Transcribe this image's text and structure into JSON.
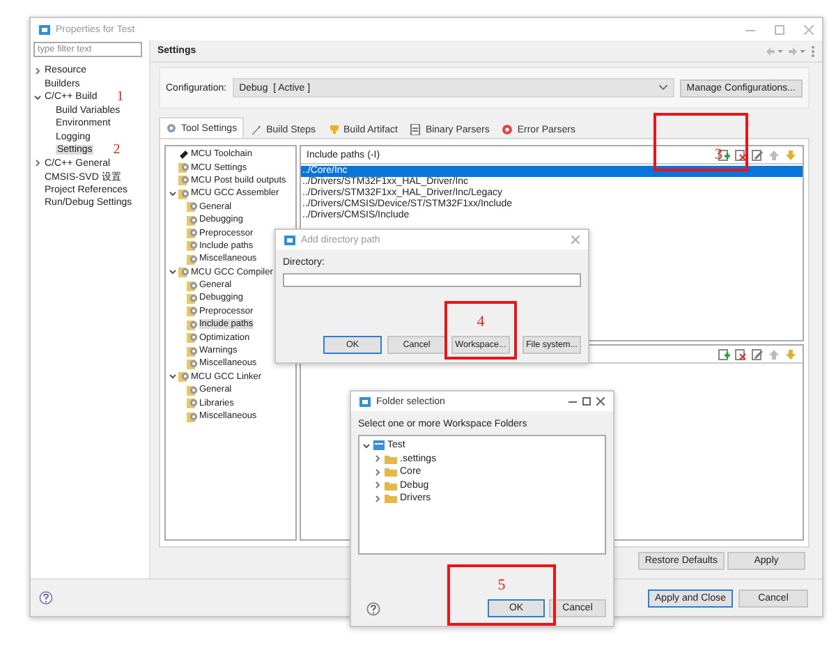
{
  "window": {
    "title": "Properties for Test",
    "filter": {
      "placeholder": "type filter text"
    }
  },
  "nav": [
    {
      "label": "Resource",
      "kind": "branch",
      "expanded": false,
      "selected": false
    },
    {
      "label": "Builders",
      "kind": "leaf",
      "selected": false
    },
    {
      "label": "C/C++ Build",
      "kind": "branch",
      "expanded": true,
      "selected": false,
      "marker": "1",
      "children": [
        {
          "label": "Build Variables",
          "kind": "leaf",
          "selected": false
        },
        {
          "label": "Environment",
          "kind": "leaf",
          "selected": false
        },
        {
          "label": "Logging",
          "kind": "leaf",
          "selected": false
        },
        {
          "label": "Settings",
          "kind": "leaf",
          "selected": true,
          "marker": "2"
        }
      ]
    },
    {
      "label": "C/C++ General",
      "kind": "branch",
      "expanded": false,
      "selected": false
    },
    {
      "label": "CMSIS-SVD 设置",
      "kind": "leaf",
      "selected": false
    },
    {
      "label": "Project References",
      "kind": "leaf",
      "selected": false
    },
    {
      "label": "Run/Debug Settings",
      "kind": "leaf",
      "selected": false
    }
  ],
  "page": {
    "title": "Settings",
    "configuration": {
      "label": "Configuration:",
      "value": "Debug  [ Active ]",
      "button": "Manage Configurations..."
    },
    "tabs": [
      {
        "label": "Tool Settings",
        "selected": true
      },
      {
        "label": "Build Steps",
        "selected": false
      },
      {
        "label": "Build Artifact",
        "selected": false
      },
      {
        "label": "Binary Parsers",
        "selected": false
      },
      {
        "label": "Error Parsers",
        "selected": false
      }
    ],
    "tool_tree": [
      {
        "label": "MCU Toolchain",
        "kind": "chip",
        "selected": false
      },
      {
        "label": "MCU Settings",
        "kind": "gear",
        "selected": false
      },
      {
        "label": "MCU Post build outputs",
        "kind": "gear",
        "selected": false
      },
      {
        "label": "MCU GCC Assembler",
        "kind": "gear",
        "expanded": true,
        "selected": false,
        "children": [
          {
            "label": "General",
            "kind": "gear",
            "selected": false
          },
          {
            "label": "Debugging",
            "kind": "gear",
            "selected": false
          },
          {
            "label": "Preprocessor",
            "kind": "gear",
            "selected": false
          },
          {
            "label": "Include paths",
            "kind": "gear",
            "selected": false
          },
          {
            "label": "Miscellaneous",
            "kind": "gear",
            "selected": false
          }
        ]
      },
      {
        "label": "MCU GCC Compiler",
        "kind": "gear",
        "expanded": true,
        "selected": false,
        "children": [
          {
            "label": "General",
            "kind": "gear",
            "selected": false
          },
          {
            "label": "Debugging",
            "kind": "gear",
            "selected": false
          },
          {
            "label": "Preprocessor",
            "kind": "gear",
            "selected": false
          },
          {
            "label": "Include paths",
            "kind": "gear",
            "selected": true
          },
          {
            "label": "Optimization",
            "kind": "gear",
            "selected": false
          },
          {
            "label": "Warnings",
            "kind": "gear",
            "selected": false
          },
          {
            "label": "Miscellaneous",
            "kind": "gear",
            "selected": false
          }
        ]
      },
      {
        "label": "MCU GCC Linker",
        "kind": "gear",
        "expanded": true,
        "selected": false,
        "children": [
          {
            "label": "General",
            "kind": "gear",
            "selected": false
          },
          {
            "label": "Libraries",
            "kind": "gear",
            "selected": false
          },
          {
            "label": "Miscellaneous",
            "kind": "gear",
            "selected": false
          }
        ]
      }
    ],
    "include_paths": {
      "title": "Include paths (-I)",
      "marker": "3",
      "items": [
        {
          "label": "../Core/Inc",
          "selected": true
        },
        {
          "label": "../Drivers/STM32F1xx_HAL_Driver/Inc",
          "selected": false
        },
        {
          "label": "../Drivers/STM32F1xx_HAL_Driver/Inc/Legacy",
          "selected": false
        },
        {
          "label": "../Drivers/CMSIS/Device/ST/STM32F1xx/Include",
          "selected": false
        },
        {
          "label": "../Drivers/CMSIS/Include",
          "selected": false
        }
      ]
    },
    "page_buttons": [
      "Restore Defaults",
      "Apply"
    ]
  },
  "footer_buttons": [
    {
      "label": "Apply and Close",
      "default": true
    },
    {
      "label": "Cancel",
      "default": false
    }
  ],
  "add_directory_dialog": {
    "title": "Add directory path",
    "label": "Directory:",
    "buttons": [
      {
        "label": "OK",
        "default": true
      },
      {
        "label": "Cancel",
        "default": false
      },
      {
        "label": "Workspace...",
        "default": false,
        "marker": "4"
      },
      {
        "label": "File system...",
        "default": false
      }
    ]
  },
  "folder_dialog": {
    "title": "Folder selection",
    "label": "Select one or more Workspace Folders",
    "tree": [
      {
        "label": "Test",
        "kind": "project",
        "expanded": true,
        "children": [
          {
            "label": ".settings",
            "kind": "folder",
            "expanded": false
          },
          {
            "label": "Core",
            "kind": "folder",
            "expanded": false
          },
          {
            "label": "Debug",
            "kind": "folder",
            "expanded": false
          },
          {
            "label": "Drivers",
            "kind": "folder",
            "expanded": false
          }
        ]
      }
    ],
    "buttons": [
      {
        "label": "OK",
        "default": true,
        "marker": "5"
      },
      {
        "label": "Cancel",
        "default": false
      }
    ]
  }
}
